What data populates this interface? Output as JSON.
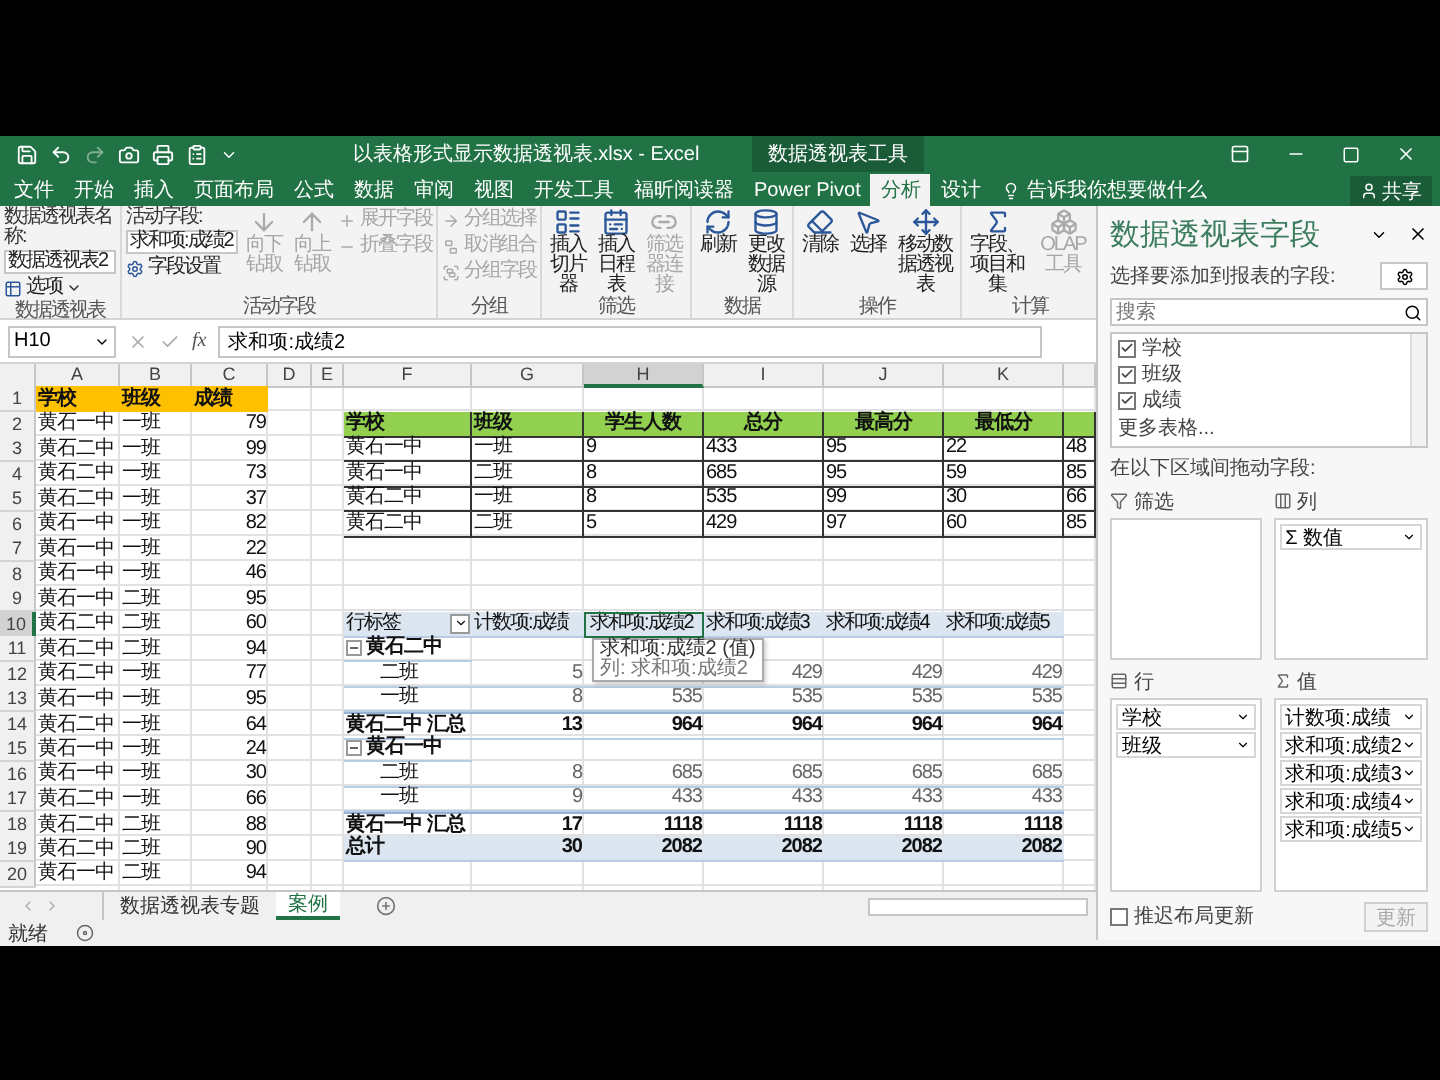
{
  "window": {
    "title": "以表格形式显示数据透视表.xlsx - Excel",
    "context_group": "数据透视表工具",
    "tell_me": "告诉我你想要做什么",
    "share": "共享"
  },
  "ribbon_tabs": [
    {
      "label": "文件",
      "selected": false
    },
    {
      "label": "开始",
      "selected": false
    },
    {
      "label": "插入",
      "selected": false
    },
    {
      "label": "页面布局",
      "selected": false
    },
    {
      "label": "公式",
      "selected": false
    },
    {
      "label": "数据",
      "selected": false
    },
    {
      "label": "审阅",
      "selected": false
    },
    {
      "label": "视图",
      "selected": false
    },
    {
      "label": "开发工具",
      "selected": false
    },
    {
      "label": "福昕阅读器",
      "selected": false
    },
    {
      "label": "Power Pivot",
      "selected": false
    },
    {
      "label": "分析",
      "selected": true
    },
    {
      "label": "设计",
      "selected": false
    }
  ],
  "ribbon_groups": [
    {
      "label": "数据透视表",
      "items": [
        {
          "kind": "stack",
          "items": [
            {
              "kind": "field",
              "label": "数据透视表名称:",
              "value": "数据透视表2"
            },
            {
              "kind": "small",
              "label": "选项",
              "disabled": false,
              "menu": true
            }
          ]
        }
      ]
    },
    {
      "label": "活动字段",
      "items": [
        {
          "kind": "stack",
          "items": [
            {
              "kind": "field",
              "label": "活动字段:",
              "value": "求和项:成绩2"
            },
            {
              "kind": "small",
              "label": "字段设置",
              "disabled": false,
              "menu": false
            }
          ]
        },
        {
          "kind": "large",
          "label": "向下钻取",
          "disabled": true
        },
        {
          "kind": "large",
          "label": "向上钻取",
          "disabled": true
        },
        {
          "kind": "stack",
          "items": [
            {
              "kind": "small",
              "label": "展开字段",
              "disabled": true,
              "menu": false
            },
            {
              "kind": "small",
              "label": "折叠字段",
              "disabled": true,
              "menu": false
            }
          ]
        }
      ]
    },
    {
      "label": "分组",
      "items": [
        {
          "kind": "stack",
          "items": [
            {
              "kind": "small",
              "label": "分组选择",
              "disabled": true,
              "menu": false
            },
            {
              "kind": "small",
              "label": "取消组合",
              "disabled": true,
              "menu": false
            },
            {
              "kind": "small",
              "label": "分组字段",
              "disabled": true,
              "menu": false
            }
          ]
        }
      ]
    },
    {
      "label": "筛选",
      "items": [
        {
          "kind": "large",
          "label": "插入切片器",
          "disabled": false
        },
        {
          "kind": "large",
          "label": "插入日程表",
          "disabled": false
        },
        {
          "kind": "large",
          "label": "筛选器连接",
          "disabled": true
        }
      ]
    },
    {
      "label": "数据",
      "items": [
        {
          "kind": "large",
          "label": "刷新",
          "disabled": false
        },
        {
          "kind": "large",
          "label": "更改数据源",
          "disabled": false
        }
      ]
    },
    {
      "label": "操作",
      "items": [
        {
          "kind": "large",
          "label": "清除",
          "disabled": false
        },
        {
          "kind": "large",
          "label": "选择",
          "disabled": false
        },
        {
          "kind": "large",
          "label": "移动数据透视表",
          "disabled": false
        }
      ]
    },
    {
      "label": "计算",
      "items": [
        {
          "kind": "large",
          "label": "字段、项目和集",
          "disabled": false
        },
        {
          "kind": "large",
          "label": "OLAP 工具",
          "disabled": true
        }
      ]
    }
  ],
  "formula_bar": {
    "name_box": "H10",
    "function_label": "fx",
    "formula": "求和项:成绩2"
  },
  "sheet": {
    "columns": [
      {
        "label": "A",
        "selected": false
      },
      {
        "label": "B",
        "selected": false
      },
      {
        "label": "C",
        "selected": false
      },
      {
        "label": "D",
        "selected": false
      },
      {
        "label": "E",
        "selected": false
      },
      {
        "label": "F",
        "selected": false
      },
      {
        "label": "G",
        "selected": false
      },
      {
        "label": "H",
        "selected": true
      },
      {
        "label": "I",
        "selected": false
      },
      {
        "label": "J",
        "selected": false
      },
      {
        "label": "K",
        "selected": false
      }
    ],
    "rows": [
      {
        "label": "1",
        "selected": false
      },
      {
        "label": "2",
        "selected": false
      },
      {
        "label": "3",
        "selected": false
      },
      {
        "label": "4",
        "selected": false
      },
      {
        "label": "5",
        "selected": false
      },
      {
        "label": "6",
        "selected": false
      },
      {
        "label": "7",
        "selected": false
      },
      {
        "label": "8",
        "selected": false
      },
      {
        "label": "9",
        "selected": false
      },
      {
        "label": "10",
        "selected": true
      },
      {
        "label": "11",
        "selected": false
      },
      {
        "label": "12",
        "selected": false
      },
      {
        "label": "13",
        "selected": false
      },
      {
        "label": "14",
        "selected": false
      },
      {
        "label": "15",
        "selected": false
      },
      {
        "label": "16",
        "selected": false
      },
      {
        "label": "17",
        "selected": false
      },
      {
        "label": "18",
        "selected": false
      },
      {
        "label": "19",
        "selected": false
      },
      {
        "label": "20",
        "selected": false
      }
    ]
  },
  "source_table": {
    "header": [
      "学校",
      "班级",
      "成绩"
    ],
    "rows": [
      [
        "黄石一中",
        "一班",
        "79"
      ],
      [
        "黄石二中",
        "一班",
        "99"
      ],
      [
        "黄石二中",
        "一班",
        "73"
      ],
      [
        "黄石二中",
        "一班",
        "37"
      ],
      [
        "黄石一中",
        "一班",
        "82"
      ],
      [
        "黄石一中",
        "一班",
        "22"
      ],
      [
        "黄石一中",
        "一班",
        "46"
      ],
      [
        "黄石一中",
        "二班",
        "95"
      ],
      [
        "黄石二中",
        "二班",
        "60"
      ],
      [
        "黄石二中",
        "二班",
        "94"
      ],
      [
        "黄石二中",
        "一班",
        "77"
      ],
      [
        "黄石一中",
        "一班",
        "95"
      ],
      [
        "黄石二中",
        "一班",
        "64"
      ],
      [
        "黄石一中",
        "一班",
        "24"
      ],
      [
        "黄石一中",
        "一班",
        "30"
      ],
      [
        "黄石二中",
        "一班",
        "66"
      ],
      [
        "黄石二中",
        "二班",
        "88"
      ],
      [
        "黄石二中",
        "二班",
        "90"
      ],
      [
        "黄石一中",
        "二班",
        "94"
      ]
    ]
  },
  "summary_table": {
    "header": [
      "学校",
      "班级",
      "学生人数",
      "总分",
      "最高分",
      "最低分"
    ],
    "rows": [
      [
        "黄石一中",
        "一班",
        "9",
        "433",
        "95",
        "22",
        "48"
      ],
      [
        "黄石一中",
        "二班",
        "8",
        "685",
        "95",
        "59",
        "85"
      ],
      [
        "黄石二中",
        "一班",
        "8",
        "535",
        "99",
        "30",
        "66"
      ],
      [
        "黄石二中",
        "二班",
        "5",
        "429",
        "97",
        "60",
        "85"
      ]
    ]
  },
  "pivot_table": {
    "header": [
      {
        "label": "行标签",
        "selected": false
      },
      {
        "label": "计数项:成绩",
        "selected": false
      },
      {
        "label": "求和项:成绩2",
        "selected": true
      },
      {
        "label": "求和项:成绩3",
        "selected": false
      },
      {
        "label": "求和项:成绩4",
        "selected": false
      },
      {
        "label": "求和项:成绩5",
        "selected": false
      }
    ],
    "rows": [
      {
        "kind": "group",
        "label": "黄石二中",
        "expanded": true
      },
      {
        "kind": "item",
        "label": "二班",
        "values": [
          "5",
          "429",
          "429",
          "429"
        ],
        "covered_value": true
      },
      {
        "kind": "item",
        "label": "一班",
        "values": [
          "8",
          "535",
          "535",
          "535",
          "535"
        ]
      },
      {
        "kind": "subtotal",
        "label": "黄石二中 汇总",
        "values": [
          "13",
          "964",
          "964",
          "964",
          "964"
        ]
      },
      {
        "kind": "group",
        "label": "黄石一中",
        "expanded": true
      },
      {
        "kind": "item",
        "label": "二班",
        "values": [
          "8",
          "685",
          "685",
          "685",
          "685"
        ]
      },
      {
        "kind": "item",
        "label": "一班",
        "values": [
          "9",
          "433",
          "433",
          "433",
          "433"
        ]
      },
      {
        "kind": "subtotal",
        "label": "黄石一中 汇总",
        "values": [
          "17",
          "1118",
          "1118",
          "1118",
          "1118"
        ]
      },
      {
        "kind": "total",
        "label": "总计",
        "values": [
          "30",
          "2082",
          "2082",
          "2082",
          "2082"
        ]
      }
    ],
    "tooltip": [
      "求和项:成绩2 (值)",
      "列: 求和项:成绩2"
    ]
  },
  "sheet_tabs": [
    {
      "label": "数据透视表专题",
      "selected": false
    },
    {
      "label": "案例",
      "selected": true
    }
  ],
  "status_bar": {
    "text": "就绪"
  },
  "field_pane": {
    "title": "数据透视表字段",
    "prompt": "选择要添加到报表的字段:",
    "search_placeholder": "搜索",
    "fields": [
      {
        "label": "学校",
        "checked": true
      },
      {
        "label": "班级",
        "checked": true
      },
      {
        "label": "成绩",
        "checked": true
      }
    ],
    "more_tables": "更多表格...",
    "drag_prompt": "在以下区域间拖动字段:",
    "areas": [
      {
        "kind": "filters",
        "label": "筛选"
      },
      {
        "kind": "columns",
        "label": "列",
        "items": [
          "Σ 数值"
        ]
      },
      {
        "kind": "rows",
        "label": "行",
        "items": [
          "学校",
          "班级"
        ]
      },
      {
        "kind": "values",
        "label": "值",
        "items": [
          "计数项:成绩",
          "求和项:成绩2",
          "求和项:成绩3",
          "求和项:成绩4",
          "求和项:成绩5"
        ]
      }
    ],
    "defer_update": {
      "label": "推迟布局更新",
      "checked": false
    },
    "update_button": {
      "label": "更新",
      "disabled": true
    }
  }
}
